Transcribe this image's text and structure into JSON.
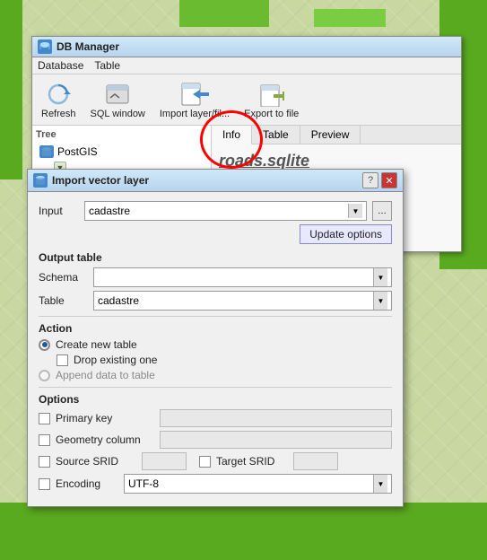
{
  "app": {
    "title": "DB Manager",
    "map_bg_color": "#c8d8a0"
  },
  "db_manager": {
    "title": "DB Manager",
    "menubar": {
      "items": [
        "Database",
        "Table"
      ]
    },
    "toolbar": {
      "buttons": [
        {
          "label": "Refresh",
          "icon": "refresh-icon"
        },
        {
          "label": "SQL window",
          "icon": "sql-icon"
        },
        {
          "label": "Import layer/fil...",
          "icon": "import-icon"
        },
        {
          "label": "Export to file",
          "icon": "export-icon"
        }
      ]
    },
    "tree": {
      "title": "Tree",
      "items": [
        "PostGIS"
      ]
    },
    "tabs": [
      "Info",
      "Table",
      "Preview"
    ],
    "active_tab": "Info",
    "info_title": "roads.sqlite"
  },
  "import_dialog": {
    "title": "Import vector layer",
    "input_label": "Input",
    "input_value": "cadastre",
    "update_btn": "Update options",
    "output_table_label": "Output table",
    "schema_label": "Schema",
    "schema_value": "",
    "table_label": "Table",
    "table_value": "cadastre",
    "action_label": "Action",
    "action_options": [
      {
        "label": "Create new table",
        "checked": true
      },
      {
        "label": "Drop existing one",
        "checked": false,
        "indent": true
      },
      {
        "label": "Append data to table",
        "checked": false
      }
    ],
    "options_label": "Options",
    "options": [
      {
        "label": "Primary key",
        "checked": false,
        "has_input": true,
        "input_value": ""
      },
      {
        "label": "Geometry column",
        "checked": false,
        "has_input": true,
        "input_value": ""
      },
      {
        "label": "Source SRID",
        "checked": false,
        "has_input": true,
        "input_value": "",
        "has_target": true,
        "target_label": "Target SRID",
        "target_value": ""
      },
      {
        "label": "Encoding",
        "checked": false,
        "has_combo": true,
        "combo_value": "UTF-8"
      }
    ]
  }
}
